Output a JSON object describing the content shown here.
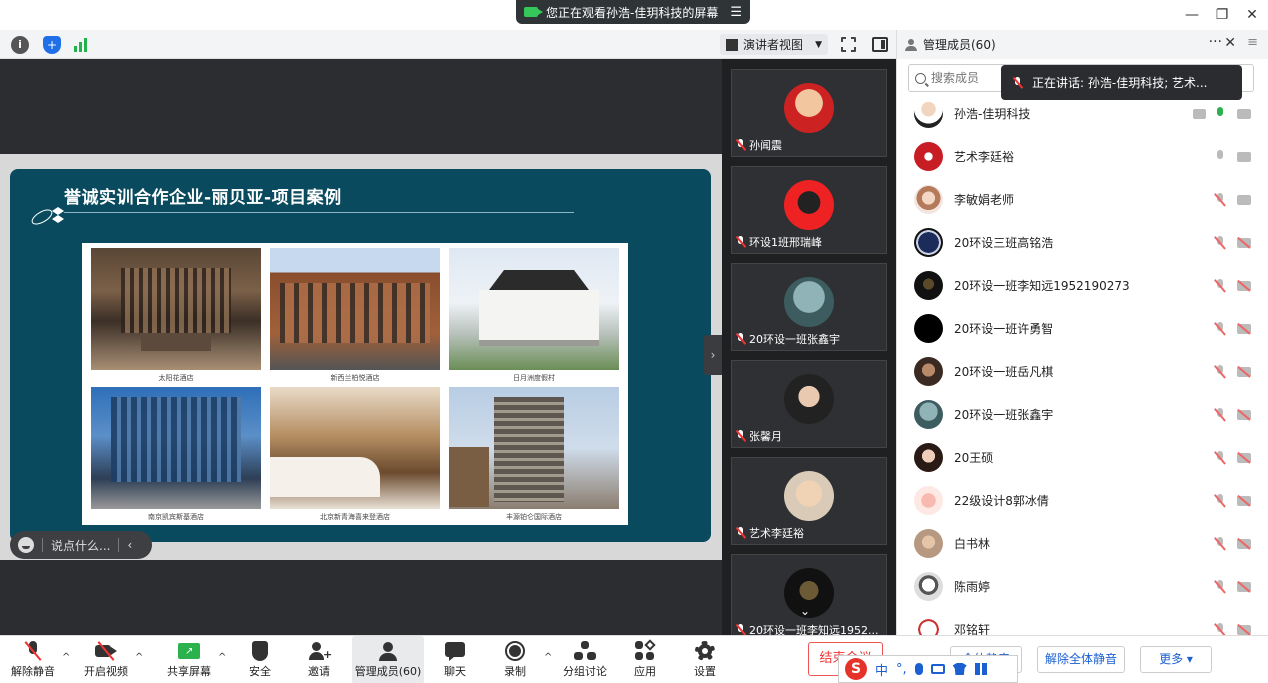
{
  "share_banner": {
    "text": "您正在观看孙浩-佳玥科技的屏幕",
    "menu_glyph": "☰"
  },
  "window": {
    "minimize": "—",
    "restore": "❐",
    "close": "✕"
  },
  "toolbar": {
    "info_glyph": "i",
    "shield_glyph": "+",
    "view_label": "演讲者视图",
    "caret": "▼"
  },
  "slide": {
    "title": "誉诚实训合作企业-丽贝亚-项目案例",
    "captions": [
      "太阳花酒店",
      "新西兰柏悦酒店",
      "日月洲度假村",
      "南京凯宾斯基酒店",
      "北京新青海喜来登酒店",
      "丰源铂仑国际酒店"
    ]
  },
  "chat": {
    "placeholder": "说点什么...",
    "collapse": "‹"
  },
  "strip": {
    "up": "^",
    "down": "⌄",
    "handle": "›",
    "tiles": [
      {
        "name": "孙闻震"
      },
      {
        "name": "环设1班邢瑞峰"
      },
      {
        "name": "20环设一班张鑫宇"
      },
      {
        "name": "张馨月"
      },
      {
        "name": "艺术李廷裕"
      },
      {
        "name": "20环设一班李知远1952..."
      }
    ]
  },
  "panel": {
    "title": "管理成员(60)",
    "more": "···",
    "close": "✕",
    "menu": "≡",
    "search_placeholder": "搜索成员",
    "speaking_tip": "正在讲话: 孙浩-佳玥科技; 艺术...",
    "members": [
      "孙浩-佳玥科技",
      "艺术李廷裕",
      "李敏娟老师",
      "20环设三班高铭浩",
      "20环设一班李知远1952190273",
      "20环设一班许勇智",
      "20环设一班岳凡棋",
      "20环设一班张鑫宇",
      "20王硕",
      "22级设计8郭冰倩",
      "白书林",
      "陈雨婷",
      "邓铭轩"
    ]
  },
  "bottom": {
    "unmute": "解除静音",
    "start_video": "开启视频",
    "share_screen": "共享屏幕",
    "security": "安全",
    "invite": "邀请",
    "manage_members": "管理成员(60)",
    "chat": "聊天",
    "record": "录制",
    "breakout": "分组讨论",
    "apps": "应用",
    "settings": "设置",
    "caret": "^",
    "end": "结束会议",
    "mute_all": "全体静音",
    "unmute_all": "解除全体静音",
    "more": "更多 ▾"
  },
  "ime": {
    "logo": "S",
    "lang": "中",
    "punct": "°,"
  }
}
